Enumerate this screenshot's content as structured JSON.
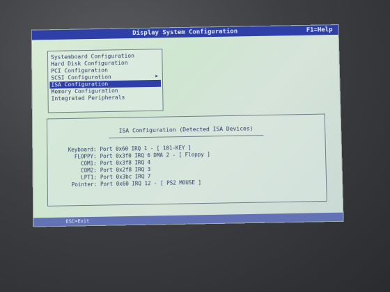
{
  "titlebar": {
    "title": "Display System Configuration",
    "help": "F1=Help"
  },
  "menu": {
    "items": [
      {
        "label": "Systemboard Configuration"
      },
      {
        "label": "Hard Disk Configuration"
      },
      {
        "label": "PCI Configuration"
      },
      {
        "label": "SCSI Configuration"
      },
      {
        "label": "ISA Configuration"
      },
      {
        "label": "Memory Configuration"
      },
      {
        "label": "Integrated Peripherals"
      }
    ],
    "selected": "ISA Configuration",
    "submenu_indicator": "▶"
  },
  "panel": {
    "title": "ISA Configuration (Detected ISA Devices)",
    "devices": [
      {
        "label": "Keyboard:",
        "value": "Port 0x60 IRQ 1 - [ 101-KEY ]"
      },
      {
        "label": "FLOPPY:",
        "value": "Port 0x3f0 IRQ 6 DMA 2 - [ Floppy ]"
      },
      {
        "label": "COM1:",
        "value": "Port 0x3f8 IRQ 4"
      },
      {
        "label": "COM2:",
        "value": "Port 0x2f8 IRQ 3"
      },
      {
        "label": "LPT1:",
        "value": "Port 0x3bc IRQ 7"
      },
      {
        "label": "Pointer:",
        "value": "Port 0x60 IRQ 12 - [ PS2 MOUSE ]"
      }
    ]
  },
  "statusbar": {
    "text": "ESC=Exit"
  }
}
